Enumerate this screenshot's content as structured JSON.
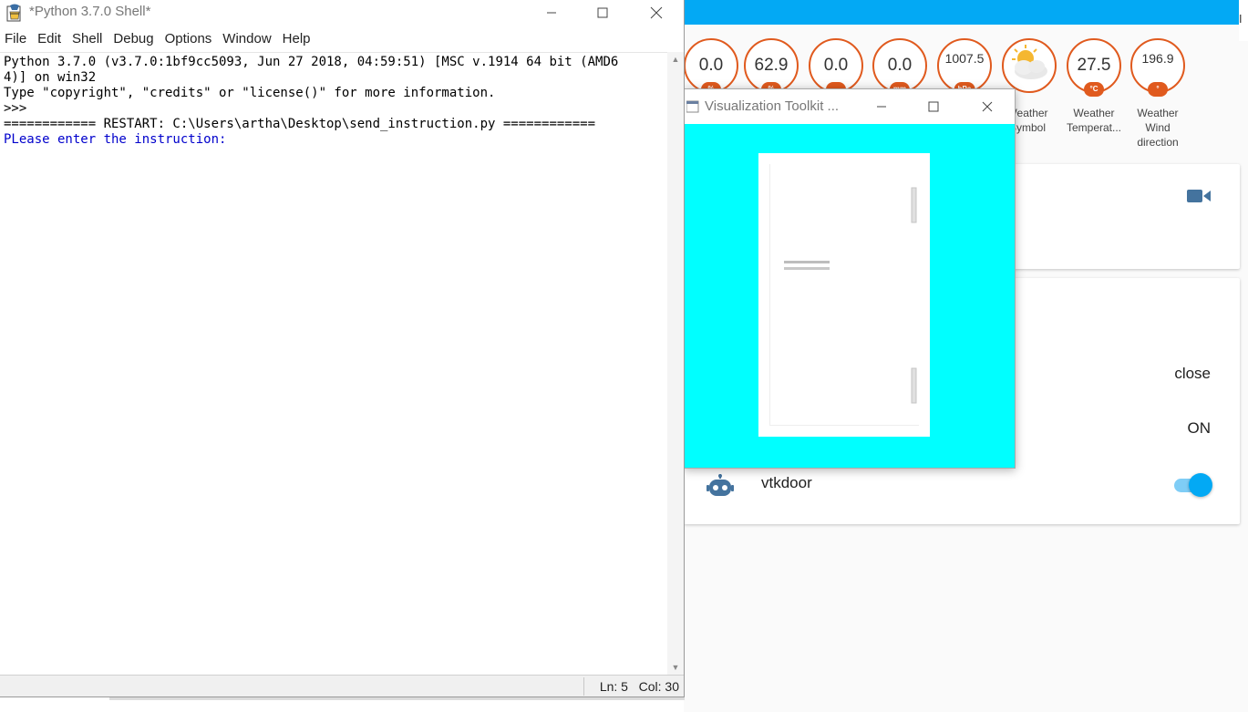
{
  "shell": {
    "title": "*Python 3.7.0 Shell*",
    "menu": [
      "File",
      "Edit",
      "Shell",
      "Debug",
      "Options",
      "Window",
      "Help"
    ],
    "lines": [
      "Python 3.7.0 (v3.7.0:1bf9cc5093, Jun 27 2018, 04:59:51) [MSC v.1914 64 bit (AMD6",
      "4)] on win32",
      "Type \"copyright\", \"credits\" or \"license()\" for more information.",
      ">>> ",
      "============ RESTART: C:\\Users\\artha\\Desktop\\send_instruction.py ============",
      "PLease enter the instruction:"
    ],
    "status": "Ln: 5   Col: 30"
  },
  "vtk": {
    "title": "Visualization Toolkit ..."
  },
  "dashboard": {
    "edge_label": "I",
    "badges": [
      {
        "value": "0.0",
        "unit": "%",
        "label": ""
      },
      {
        "value": "62.9",
        "unit": "%",
        "label": ""
      },
      {
        "value": "0.0",
        "unit": "",
        "label": ""
      },
      {
        "value": "0.0",
        "unit": "mm",
        "label": ""
      },
      {
        "value": "1007.5",
        "unit": "hPa",
        "label": ""
      },
      {
        "value": "",
        "unit": "",
        "label": "Weather Symbol"
      },
      {
        "value": "27.5",
        "unit": "°C",
        "label": "Weather Temperat..."
      },
      {
        "value": "196.9",
        "unit": "°",
        "label": "Weather Wind direction"
      }
    ],
    "card2": {
      "door_state": "close",
      "switch_state": "ON",
      "entity_name": "vtkdoor",
      "toggle_on": true
    },
    "colors": {
      "accent": "#03a9f4",
      "badge": "#e05a1e",
      "vtk_background": "#00ffff"
    }
  }
}
